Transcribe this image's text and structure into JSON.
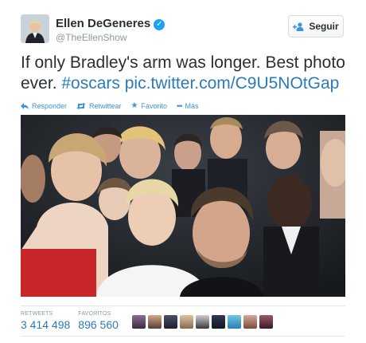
{
  "user": {
    "name": "Ellen DeGeneres",
    "handle": "@TheEllenShow",
    "verified_icon": "verified-badge-icon",
    "avatar_icon": "profile-avatar"
  },
  "follow_button": {
    "label": "Seguir",
    "icon": "add-user-icon"
  },
  "tweet": {
    "text_part1": "If only Bradley's arm was longer. Best photo ever. ",
    "hashtag": "#oscars",
    "link": "pic.twitter.com/C9U5NOtGap"
  },
  "actions": [
    {
      "label": "Responder",
      "icon": "reply-icon"
    },
    {
      "label": "Retwittear",
      "icon": "retweet-icon"
    },
    {
      "label": "Favorito",
      "icon": "star-icon"
    },
    {
      "label": "Más",
      "icon": "more-dots-icon"
    }
  ],
  "stats": {
    "retweets_label": "RETWEETS",
    "retweets_value": "3 414 498",
    "favorites_label": "FAVORITOS",
    "favorites_value": "896 560"
  },
  "colors": {
    "link": "#2b7bb9",
    "action": "#3b94d9",
    "verified": "#1da1f2",
    "muted": "#8899a6"
  }
}
